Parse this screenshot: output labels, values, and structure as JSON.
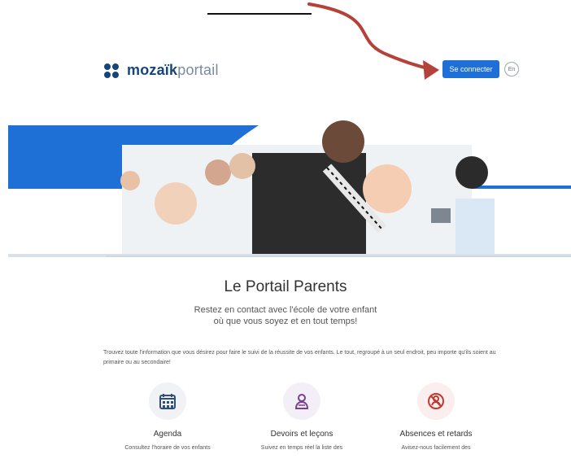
{
  "header": {
    "logo_bold": "mozaïk",
    "logo_light": "portail",
    "connect_label": "Se connecter",
    "lang_label": "En"
  },
  "main": {
    "title": "Le Portail Parents",
    "subtitle_line1": "Restez en contact avec l'école de votre enfant",
    "subtitle_line2": "où que vous soyez et en tout temps!",
    "intro": "Trouvez toute l'information que vous désirez pour faire le suivi de la réussite de vos enfants. Le tout, regroupé à un seul endroit, peu importe qu'ils soient au primaire ou au secondaire!"
  },
  "features": [
    {
      "icon": "calendar-icon",
      "title": "Agenda",
      "desc": "Consultez l'horaire de vos enfants"
    },
    {
      "icon": "homework-icon",
      "title": "Devoirs et leçons",
      "desc": "Suivez en temps réel la liste des"
    },
    {
      "icon": "absence-icon",
      "title": "Absences et retards",
      "desc": "Avisez-nous facilement des"
    }
  ],
  "colors": {
    "brand": "#16457a",
    "accent": "#1e6fd6",
    "arrow": "#b6403a",
    "feature_icon_calendar": "#2f4f7a",
    "feature_icon_homework": "#7a3f8e",
    "feature_icon_absence": "#c0392b"
  }
}
